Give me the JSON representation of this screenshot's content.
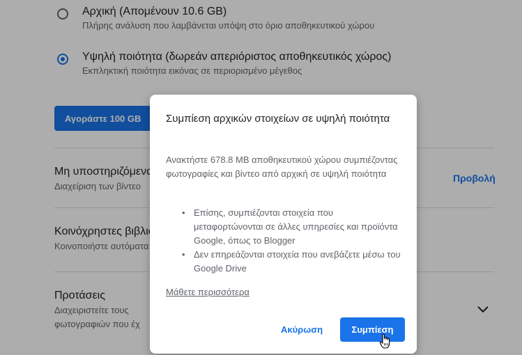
{
  "settings": {
    "original": {
      "title": "Αρχική (Απομένουν 10.6 GB)",
      "subtitle": "Πλήρης ανάλυση που λαμβάνεται υπόψη στο όριο αποθηκευτικού χώρου"
    },
    "high_quality": {
      "title": "Υψηλή ποιότητα (δωρεάν απεριόριστος αποθηκευτικός χώρος)",
      "subtitle": "Εκπληκτική ποιότητα εικόνας σε περιορισμένο μέγεθος"
    },
    "buy_button": "Αγοράστε 100 GB",
    "unsupported": {
      "title": "Μη υποστηριζόμενα",
      "subtitle": "Διαχείριση των βίντεο",
      "link": "Προβολή"
    },
    "shared_libraries": {
      "title": "Κοινόχρηστες βιβλιοθήκες",
      "subtitle": "Κοινοποιήστε αυτόματα"
    },
    "suggestions": {
      "title": "Προτάσεις",
      "subtitle_line1": "Διαχειριστείτε τους",
      "subtitle_line2": "φωτογραφιών που έχ"
    }
  },
  "dialog": {
    "title": "Συμπίεση αρχικών στοιχείων σε υψηλή ποιότητα",
    "body": "Ανακτήστε 678.8 MB αποθηκευτικού χώρου συμπιέζοντας φωτογραφίες και βίντεο από αρχική σε υψηλή ποιότητα",
    "bullets": [
      "Επίσης, συμπιέζονται στοιχεία που μεταφορτώνονται σε άλλες υπηρεσίες και προϊόντα Google, όπως το Blogger",
      "Δεν επηρεάζονται στοιχεία που ανεβάζετε μέσω του Google Drive"
    ],
    "learn_more": "Μάθετε περισσότερα",
    "cancel": "Ακύρωση",
    "confirm": "Συμπίεση"
  },
  "colors": {
    "accent": "#1a73e8",
    "scrim": "rgba(0,0,0,0.32)"
  },
  "icons": {
    "chevron": "chevron-down-icon",
    "cursor": "hand-pointer-icon"
  }
}
